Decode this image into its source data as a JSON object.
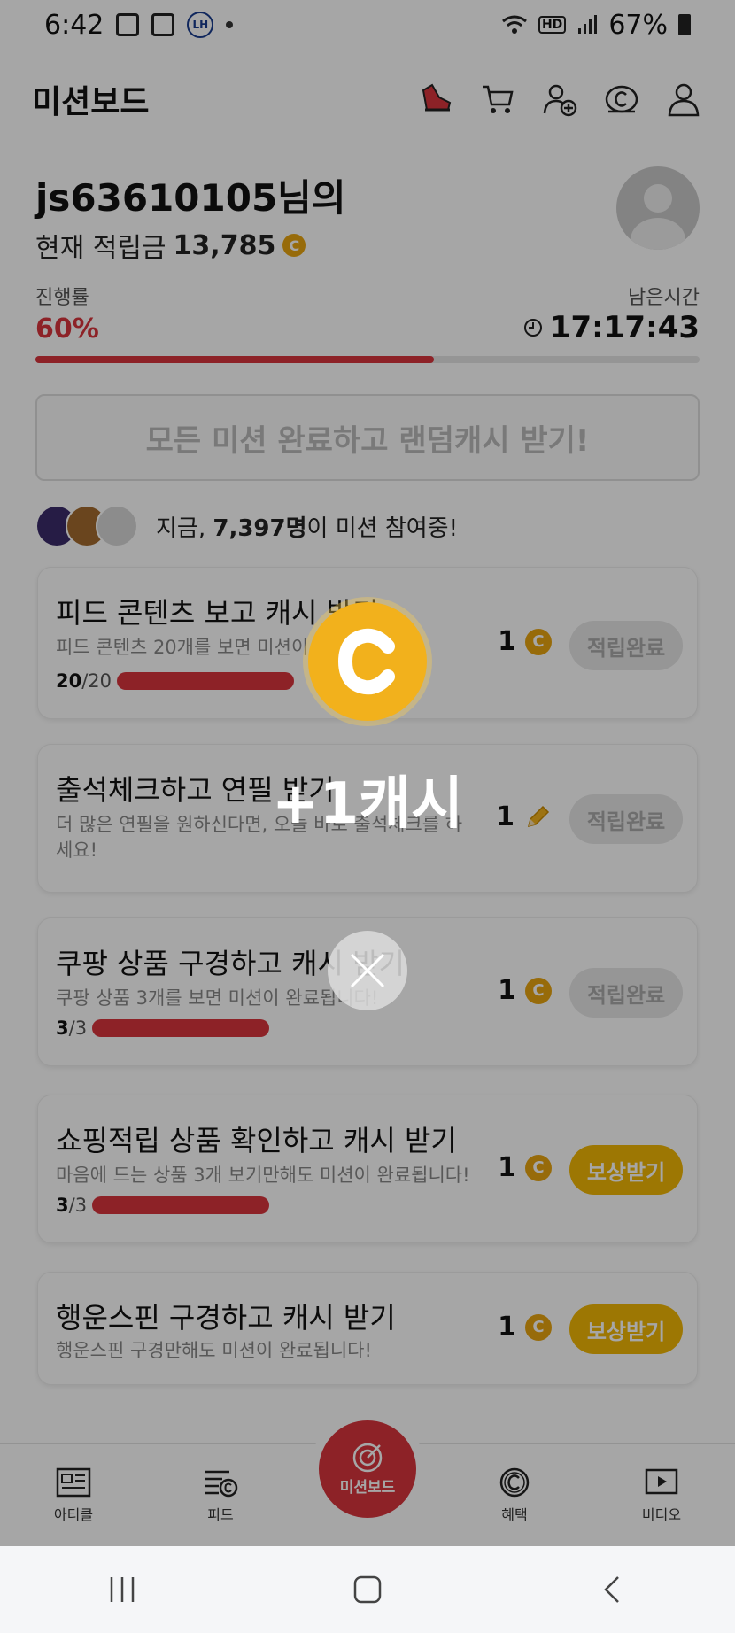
{
  "status_bar": {
    "time": "6:42",
    "lh_badge": "LH",
    "hd_label": "HD",
    "battery": "67%"
  },
  "header": {
    "title": "미션보드"
  },
  "profile": {
    "username": "js63610105님의",
    "balance_label": "현재 적립금",
    "balance": "13,785"
  },
  "progress": {
    "label": "진행률",
    "percent": "60%",
    "percent_value": 60,
    "remaining_label": "남은시간",
    "remaining_time": "17:17:43"
  },
  "random_banner": "모든 미션 완료하고 랜덤캐시 받기!",
  "participants": {
    "prefix": "지금, ",
    "count": "7,397명",
    "suffix": "이 미션 참여중!"
  },
  "missions": [
    {
      "title": "피드 콘텐츠 보고 캐시 받기",
      "desc": "피드 콘텐츠 20개를 보면 미션이 완료됩니다!",
      "done": "20",
      "total": "/20",
      "reward": "1",
      "reward_icon": "coin-icon",
      "button": "적립완료"
    },
    {
      "title": "출석체크하고 연필 받기",
      "desc": "더 많은 연필을 원하신다면, 오늘 바로 출석체크를 하세요!",
      "reward": "1",
      "reward_icon": "pencil-icon",
      "button": "적립완료"
    },
    {
      "title": "쿠팡 상품 구경하고 캐시 받기",
      "desc": "쿠팡 상품 3개를 보면 미션이 완료됩니다!",
      "done": "3",
      "total": "/3",
      "reward": "1",
      "reward_icon": "coin-icon",
      "button": "적립완료"
    },
    {
      "title": "쇼핑적립 상품 확인하고 캐시 받기",
      "desc": "마음에 드는 상품 3개 보기만해도 미션이 완료됩니다!",
      "done": "3",
      "total": "/3",
      "reward": "1",
      "reward_icon": "coin-icon",
      "button": "보상받기"
    },
    {
      "title": "행운스핀 구경하고 캐시 받기",
      "desc": "행운스핀 구경만해도 미션이 완료됩니다!",
      "reward": "1",
      "reward_icon": "coin-icon",
      "button": "보상받기"
    }
  ],
  "bottom_nav": {
    "article": "아티클",
    "feed": "피드",
    "mission": "미션보드",
    "benefit": "혜택",
    "video": "비디오"
  },
  "overlay": {
    "cash_text": "+1캐시"
  },
  "colors": {
    "accent_red": "#d9353d",
    "coin_gold": "#f2b11c",
    "reward_button": "#f2b705"
  }
}
